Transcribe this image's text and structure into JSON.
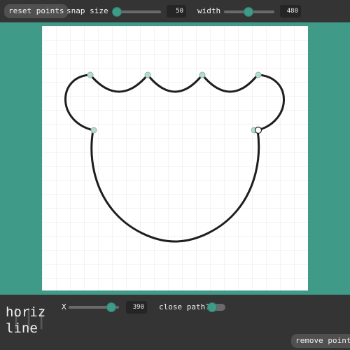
{
  "toolbar": {
    "reset_label": "reset points",
    "snap_label": "snap size",
    "snap_value": "50",
    "width_label": "width",
    "width_value": "480"
  },
  "canvas": {
    "grid_visible": true,
    "path": "closed curve of connected arcs: four small scallops across the top, a large circular arc at the bottom",
    "stroke_color": "#1e1e1e",
    "point_color": "#b9d9cf",
    "selected_point_color": "#ffffff"
  },
  "panel": {
    "mode_label": "horiz\nline",
    "x_label": "X",
    "x_value": "390",
    "close_label": "close path?",
    "remove_label": "remove point"
  },
  "colors": {
    "accent": "#3f9a88",
    "toolbar_bg": "#343434",
    "button_bg": "#505050"
  }
}
